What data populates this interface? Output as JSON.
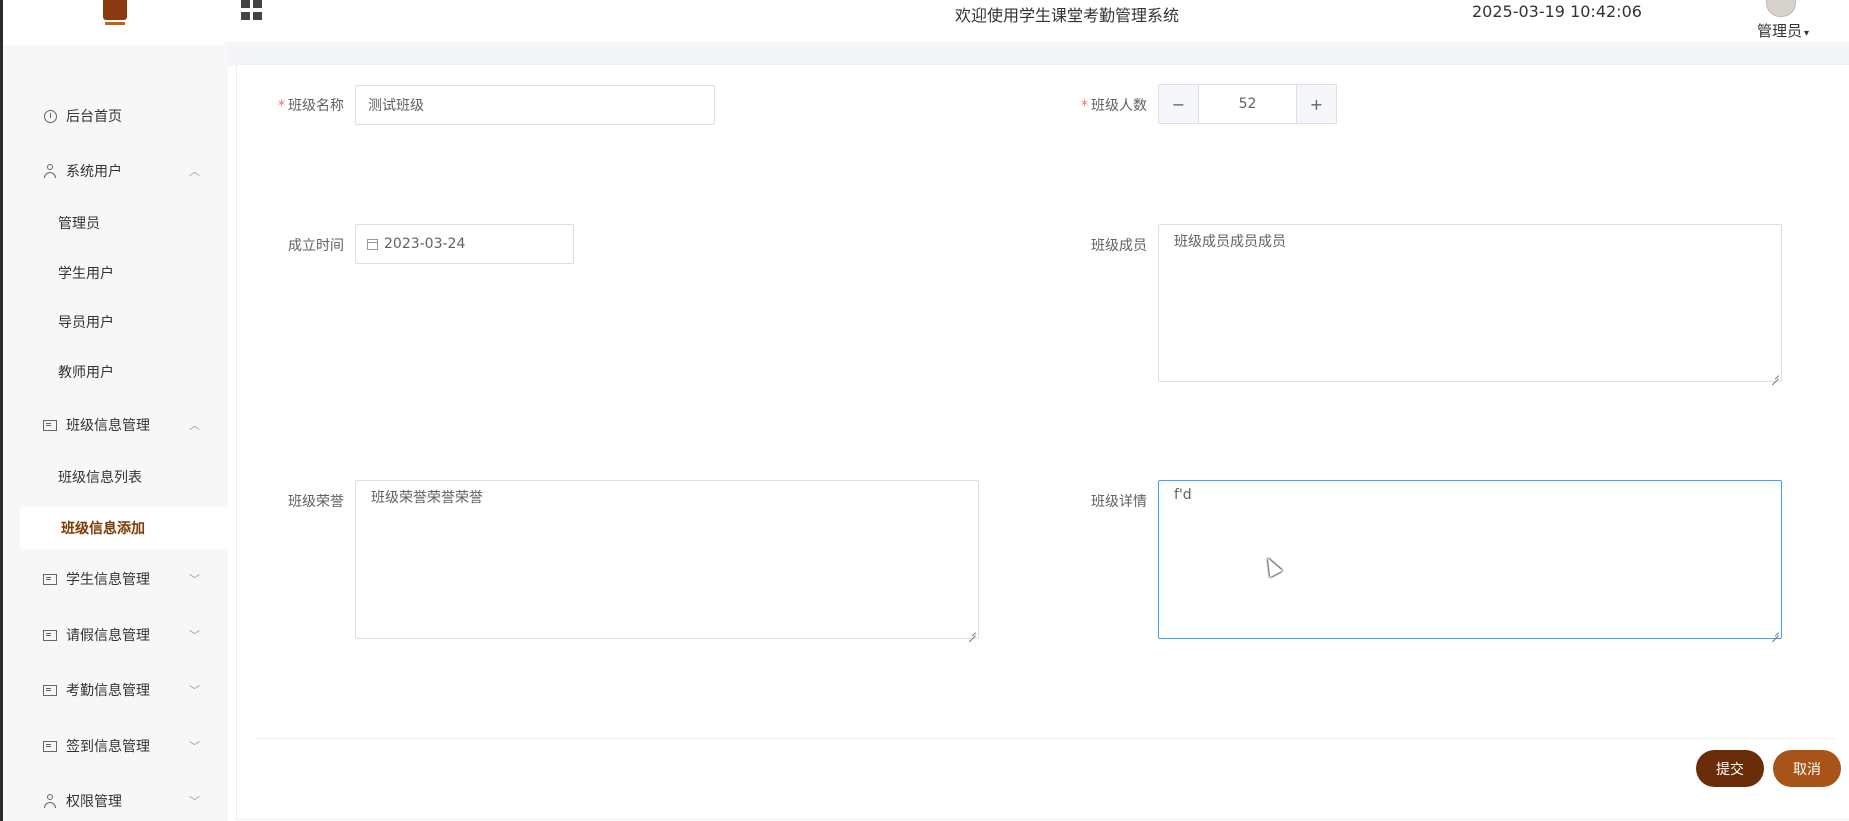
{
  "header": {
    "system_title": "欢迎使用学生课堂考勤管理系统",
    "datetime": "2025-03-19 10:42:06",
    "user_name": "管理员",
    "caret": "▾"
  },
  "sidebar": {
    "items": [
      {
        "label": "后台首页",
        "icon": "clock-icon"
      },
      {
        "label": "系统用户",
        "icon": "user-icon",
        "expanded": true
      },
      {
        "label": "管理员"
      },
      {
        "label": "学生用户"
      },
      {
        "label": "导员用户"
      },
      {
        "label": "教师用户"
      },
      {
        "label": "班级信息管理",
        "icon": "card-icon",
        "expanded": true
      },
      {
        "label": "班级信息列表"
      },
      {
        "label": "班级信息添加",
        "active": true
      },
      {
        "label": "学生信息管理",
        "icon": "card-icon"
      },
      {
        "label": "请假信息管理",
        "icon": "card-icon"
      },
      {
        "label": "考勤信息管理",
        "icon": "card-icon"
      },
      {
        "label": "签到信息管理",
        "icon": "card-icon"
      },
      {
        "label": "权限管理",
        "icon": "user-icon"
      }
    ],
    "chev_up": "︿",
    "chev_down": "﹀"
  },
  "form": {
    "class_name_label": "班级名称",
    "class_name_value": "测试班级",
    "class_count_label": "班级人数",
    "class_count_value": "52",
    "minus": "−",
    "plus": "+",
    "established_label": "成立时间",
    "established_value": "2023-03-24",
    "members_label": "班级成员",
    "members_value": "班级成员成员成员",
    "honors_label": "班级荣誉",
    "honors_value": "班级荣誉荣誉荣誉",
    "details_label": "班级详情",
    "details_value": "f'd",
    "required_mark": "*"
  },
  "actions": {
    "submit": "提交",
    "cancel": "取消"
  },
  "colors": {
    "accent_dark": "#6b2c0a",
    "accent": "#a85418",
    "active_text": "#7a3b05",
    "focus_border": "#409eff"
  }
}
